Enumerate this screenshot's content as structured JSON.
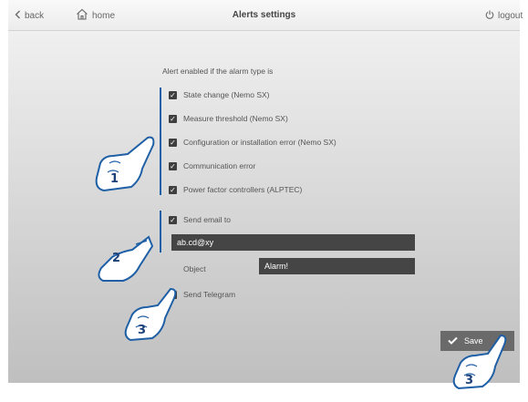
{
  "topbar": {
    "back_label": "back",
    "home_label": "home",
    "title": "Alerts settings",
    "logout_label": "logout"
  },
  "alerts": {
    "intro": "Alert enabled if the alarm type is",
    "items": [
      {
        "label": "State change (Nemo SX)",
        "checked": true
      },
      {
        "label": "Measure threshold (Nemo SX)",
        "checked": true
      },
      {
        "label": "Configuration or installation error (Nemo SX)",
        "checked": true
      },
      {
        "label": "Communication error",
        "checked": true
      },
      {
        "label": "Power factor controllers (ALPTEC)",
        "checked": true
      }
    ]
  },
  "email": {
    "label": "Send email to",
    "checked": true,
    "address": "ab.cd@xy",
    "object_label": "Object",
    "object_value": "Alarm!"
  },
  "telegram": {
    "label": "Send Telegram",
    "checked": true
  },
  "save_label": "Save",
  "callouts": [
    "1",
    "2",
    "3",
    "3"
  ],
  "colors": {
    "accent_line": "#1e5fa6",
    "field_bg": "#454545",
    "save_bg": "#6a6a6a"
  },
  "icons": {
    "back": "chevron-left-icon",
    "home": "home-icon",
    "logout": "power-icon",
    "check": "check-icon",
    "pointer": "pointing-hand-icon"
  }
}
